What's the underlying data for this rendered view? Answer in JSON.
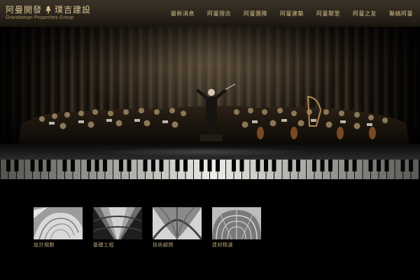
{
  "header": {
    "brand": {
      "name_left": "阿曼開發",
      "name_right": "璞吉建設",
      "subtitle": "Grandaman Properties Group"
    },
    "nav": [
      {
        "label": "最新消息"
      },
      {
        "label": "阿曼理念"
      },
      {
        "label": "阿曼團隊"
      },
      {
        "label": "阿曼建築"
      },
      {
        "label": "阿曼鄰里"
      },
      {
        "label": "阿曼之友"
      },
      {
        "label": "聯絡阿曼"
      }
    ]
  },
  "hero": {
    "image": "orchestra-with-conductor-and-piano-keys"
  },
  "services": [
    {
      "label": "設計規劃",
      "image": "white-spiral-architecture"
    },
    {
      "label": "基礎工程",
      "image": "stone-column-vault"
    },
    {
      "label": "技術顧問",
      "image": "gothic-ceiling-vault"
    },
    {
      "label": "建材精選",
      "image": "arched-skylight-ceiling"
    }
  ],
  "colors": {
    "gold": "#d6c08e",
    "background": "#000000"
  }
}
